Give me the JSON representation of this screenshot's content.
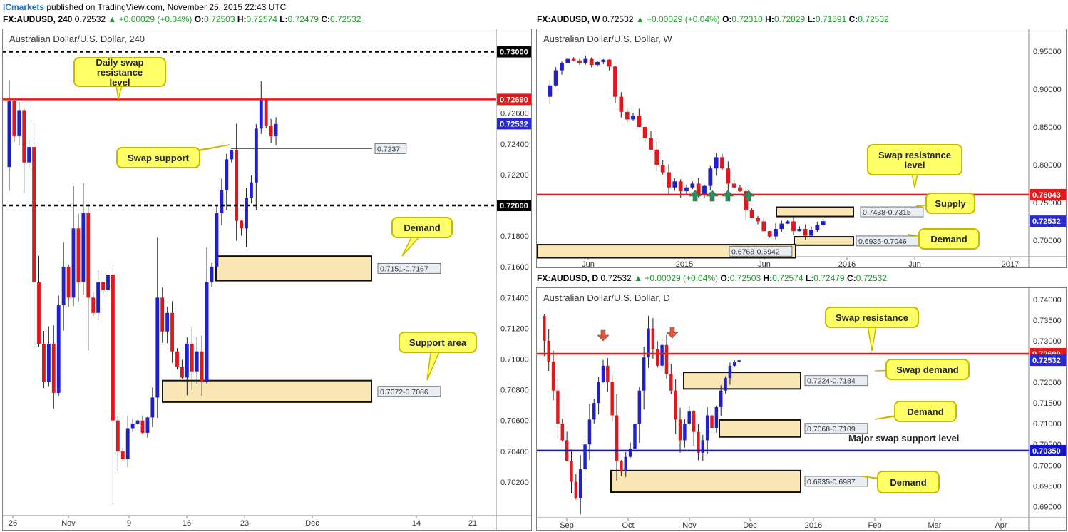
{
  "header": {
    "brand": "ICmarkets",
    "published": "published on TradingView.com, November 25, 2015 22:43 UTC"
  },
  "panels": {
    "left": {
      "symbol": "FX:AUDUSD, 240",
      "price": "0.72532",
      "change": "+0.00029 (+0.04%)",
      "o": "0.72503",
      "h": "0.72574",
      "l": "0.72479",
      "c": "0.72532",
      "title": "Australian Dollar/U.S. Dollar, 240"
    },
    "weekly": {
      "symbol": "FX:AUDUSD, W",
      "price": "0.72532",
      "change": "+0.00029 (+0.04%)",
      "o": "0.72310",
      "h": "0.72829",
      "l": "0.71591",
      "c": "0.72532",
      "title": "Australian Dollar/U.S. Dollar, W"
    },
    "daily": {
      "symbol": "FX:AUDUSD, D",
      "price": "0.72532",
      "change": "+0.00029 (+0.04%)",
      "o": "0.72503",
      "h": "0.72574",
      "l": "0.72479",
      "c": "0.72532",
      "title": "Australian Dollar/U.S. Dollar, D"
    }
  },
  "hdr_labels": {
    "o": "O:",
    "h": "H:",
    "l": "L:",
    "c": "C:"
  },
  "colors": {
    "bull": "#1f1fd0",
    "bear": "#e3161b",
    "resistance": "#e31a1c",
    "support_blue": "#1414c8",
    "zone_fill": "#fbe7b5",
    "callout": "#ffff66",
    "arrow_green": "#2e8b57",
    "arrow_red": "#e05a3c"
  },
  "chart_data": [
    {
      "id": "h4",
      "type": "candlestick",
      "title": "Australian Dollar/U.S. Dollar, 240",
      "ylim": [
        0.7,
        0.731
      ],
      "y_ticks": [
        "0.72600",
        "0.72400",
        "0.72200",
        "0.71800",
        "0.71600",
        "0.71400",
        "0.71200",
        "0.71000",
        "0.70800",
        "0.70600",
        "0.70400",
        "0.70200"
      ],
      "y_tick_values": [
        0.726,
        0.724,
        0.722,
        0.718,
        0.716,
        0.714,
        0.712,
        0.71,
        0.708,
        0.706,
        0.704,
        0.702
      ],
      "x_ticks": [
        "26",
        "Nov",
        "9",
        "16",
        "23",
        "Dec",
        "14",
        "21"
      ],
      "levels": [
        {
          "value": 0.73,
          "label": "0.73000",
          "style": "dashed",
          "color": "#000"
        },
        {
          "value": 0.7269,
          "label": "0.72690",
          "style": "solid",
          "color": "#e31a1c"
        },
        {
          "value": 0.7237,
          "label": "0.7237",
          "style": "thin",
          "color": "#333"
        },
        {
          "value": 0.72,
          "label": "0.72000",
          "style": "dashed",
          "color": "#000"
        }
      ],
      "last_price": {
        "value": 0.72532,
        "label": "0.72532"
      },
      "zones": [
        {
          "from": 0.7151,
          "to": 0.7167,
          "label": "0.7151-0.7167"
        },
        {
          "from": 0.7072,
          "to": 0.7086,
          "label": "0.7072-0.7086"
        }
      ],
      "annotations": [
        "Daily swap resistance level",
        "Swap support",
        "Demand",
        "Support area"
      ],
      "path": [
        0.7225,
        0.7268,
        0.7245,
        0.7262,
        0.7228,
        0.7238,
        0.715,
        0.711,
        0.7085,
        0.711,
        0.7078,
        0.7135,
        0.716,
        0.714,
        0.7185,
        0.715,
        0.7195,
        0.714,
        0.713,
        0.715,
        0.7145,
        0.7155,
        0.706,
        0.704,
        0.7035,
        0.7055,
        0.7058,
        0.706,
        0.7052,
        0.7062,
        0.7075,
        0.714,
        0.7118,
        0.713,
        0.7105,
        0.7095,
        0.7088,
        0.711,
        0.7092,
        0.7105,
        0.7085,
        0.715,
        0.716,
        0.7195,
        0.721,
        0.723,
        0.7236,
        0.719,
        0.7185,
        0.7205,
        0.7215,
        0.725,
        0.7269,
        0.7252,
        0.7245,
        0.7253
      ]
    },
    {
      "id": "weekly",
      "type": "candlestick",
      "title": "Australian Dollar/U.S. Dollar, W",
      "ylim": [
        0.682,
        0.968
      ],
      "y_ticks": [
        "0.95000",
        "0.90000",
        "0.85000",
        "0.80000",
        "0.75000",
        "0.70000"
      ],
      "y_tick_values": [
        0.95,
        0.9,
        0.85,
        0.8,
        0.75,
        0.7
      ],
      "x_ticks": [
        "Jun",
        "2015",
        "Jun",
        "2016",
        "Jun",
        "2017"
      ],
      "levels": [
        {
          "value": 0.76043,
          "label": "0.76043",
          "style": "solid",
          "color": "#e31a1c"
        }
      ],
      "last_price": {
        "value": 0.72532,
        "label": "0.72532"
      },
      "zones": [
        {
          "from": 0.7315,
          "to": 0.7438,
          "label": "0.7438-0.7315"
        },
        {
          "from": 0.6935,
          "to": 0.7046,
          "label": "0.6935-0.7046"
        },
        {
          "from": 0.6768,
          "to": 0.6942,
          "label": "0.6768-0.6942"
        }
      ],
      "annotations": [
        "Swap resistance level",
        "Supply",
        "Demand"
      ],
      "path": [
        0.89,
        0.905,
        0.925,
        0.935,
        0.94,
        0.938,
        0.935,
        0.94,
        0.932,
        0.936,
        0.939,
        0.93,
        0.89,
        0.87,
        0.86,
        0.865,
        0.85,
        0.835,
        0.82,
        0.8,
        0.79,
        0.77,
        0.778,
        0.765,
        0.77,
        0.775,
        0.76,
        0.772,
        0.795,
        0.81,
        0.795,
        0.775,
        0.77,
        0.765,
        0.74,
        0.73,
        0.725,
        0.712,
        0.705,
        0.715,
        0.722,
        0.725,
        0.712,
        0.715,
        0.706,
        0.714,
        0.72,
        0.7253
      ]
    },
    {
      "id": "daily",
      "type": "candlestick",
      "title": "Australian Dollar/U.S. Dollar, D",
      "ylim": [
        0.688,
        0.741
      ],
      "y_ticks": [
        "0.74000",
        "0.73500",
        "0.73000",
        "0.72000",
        "0.71500",
        "0.71000",
        "0.70500",
        "0.70000",
        "0.69500",
        "0.69000"
      ],
      "y_tick_values": [
        0.74,
        0.735,
        0.73,
        0.72,
        0.715,
        0.71,
        0.705,
        0.7,
        0.695,
        0.69
      ],
      "x_ticks": [
        "Sep",
        "Oct",
        "Nov",
        "Dec",
        "2016",
        "Feb",
        "Mar",
        "Apr"
      ],
      "levels": [
        {
          "value": 0.7269,
          "label": "0.72690",
          "style": "solid",
          "color": "#e31a1c"
        },
        {
          "value": 0.7035,
          "label": "0.70350",
          "style": "solid",
          "color": "#1414c8"
        }
      ],
      "last_price": {
        "value": 0.72532,
        "label": "0.72532"
      },
      "zones": [
        {
          "from": 0.7184,
          "to": 0.7224,
          "label": "0.7224-0.7184"
        },
        {
          "from": 0.7068,
          "to": 0.7109,
          "label": "0.7068-0.7109"
        },
        {
          "from": 0.6935,
          "to": 0.6987,
          "label": "0.6935-0.6987"
        }
      ],
      "annotations": [
        "Swap resistance",
        "Swap demand",
        "Demand",
        "Major swap support level",
        "Demand"
      ],
      "path": [
        0.736,
        0.73,
        0.725,
        0.718,
        0.71,
        0.706,
        0.701,
        0.696,
        0.692,
        0.699,
        0.705,
        0.711,
        0.715,
        0.72,
        0.724,
        0.72,
        0.712,
        0.701,
        0.6985,
        0.702,
        0.704,
        0.71,
        0.718,
        0.726,
        0.733,
        0.728,
        0.724,
        0.729,
        0.722,
        0.718,
        0.711,
        0.706,
        0.71,
        0.713,
        0.708,
        0.703,
        0.706,
        0.712,
        0.709,
        0.714,
        0.718,
        0.721,
        0.724,
        0.725,
        0.7253
      ]
    }
  ],
  "callouts": {
    "h4_daily_swap": "Daily swap resistance level",
    "h4_swap_support": "Swap support",
    "h4_demand": "Demand",
    "h4_support_area": "Support area",
    "w_swap_res": "Swap resistance level",
    "w_supply": "Supply",
    "w_demand": "Demand",
    "d_swap_res": "Swap resistance",
    "d_swap_demand": "Swap demand",
    "d_demand1": "Demand",
    "d_major": "Major swap support level",
    "d_demand2": "Demand"
  }
}
